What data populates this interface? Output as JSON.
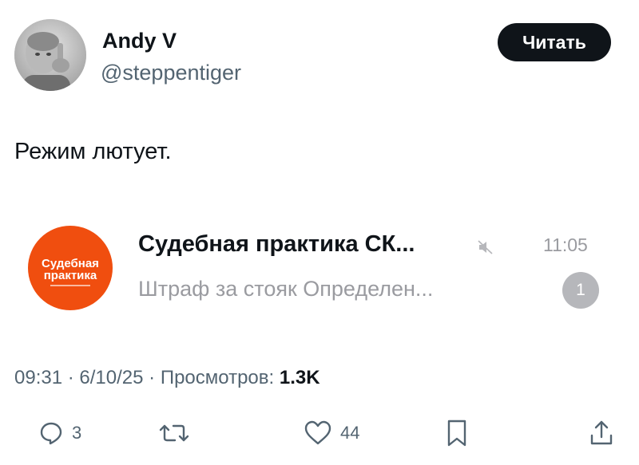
{
  "author": {
    "name": "Andy V",
    "handle": "@steppentiger"
  },
  "read_button": "Читать",
  "tweet_text": "Режим лютует.",
  "embedded_chat": {
    "avatar_text_line1": "Судебная",
    "avatar_text_line2": "практика",
    "avatar_color": "#f04e0f",
    "title": "Судебная практика СК...",
    "time": "11:05",
    "preview": "Штраф за стояк  Определен...",
    "unread_count": "1",
    "muted": true
  },
  "meta": {
    "time": "09:31",
    "date": "6/10/25",
    "views_label": "Просмотров:",
    "views_count": "1.3K"
  },
  "actions": {
    "replies": "3",
    "retweets": "",
    "likes": "44"
  }
}
